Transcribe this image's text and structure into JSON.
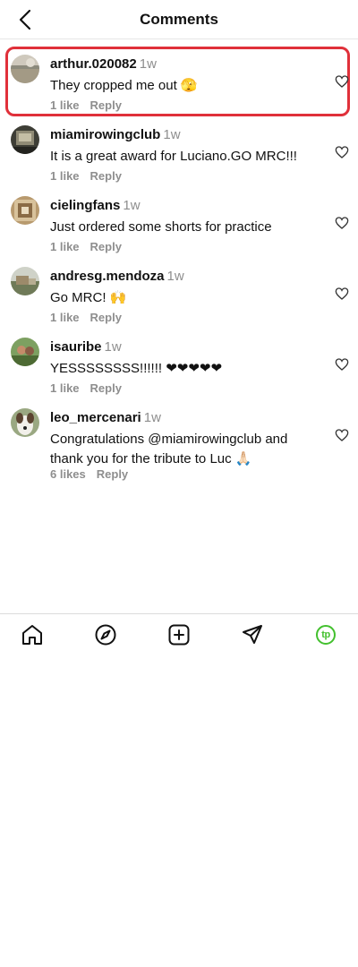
{
  "header": {
    "title": "Comments"
  },
  "comments": [
    {
      "username": "arthur.020082",
      "time": "1w",
      "text": "They cropped me out 🫣",
      "likes": "1 like",
      "reply": "Reply"
    },
    {
      "username": "miamirowingclub",
      "time": "1w",
      "text": "It is a great award for Luciano.GO MRC!!!",
      "likes": "1 like",
      "reply": "Reply"
    },
    {
      "username": "cielingfans",
      "time": "1w",
      "text": "Just ordered some shorts for practice",
      "likes": "1 like",
      "reply": "Reply"
    },
    {
      "username": "andresg.mendoza",
      "time": "1w",
      "text": "Go MRC! 🙌",
      "likes": "1 like",
      "reply": "Reply"
    },
    {
      "username": "isauribe",
      "time": "1w",
      "text": "YESSSSSSSS!!!!!! ❤❤❤❤❤",
      "likes": "1 like",
      "reply": "Reply"
    },
    {
      "username": "leo_mercenari",
      "time": "1w",
      "text": "Congratulations @miamirowingclub and thank you for the tribute to Luc 🙏🏻",
      "likes": "6 likes",
      "reply": "Reply"
    }
  ],
  "tabbar": {
    "items": [
      "home-icon",
      "explore-icon",
      "new-post-icon",
      "direct-message-icon",
      "profile-avatar"
    ],
    "profile_initials": "tp",
    "profile_color": "#43c02e"
  },
  "colors": {
    "highlight": "#e0303a",
    "secondary_text": "#8e8e8e"
  }
}
